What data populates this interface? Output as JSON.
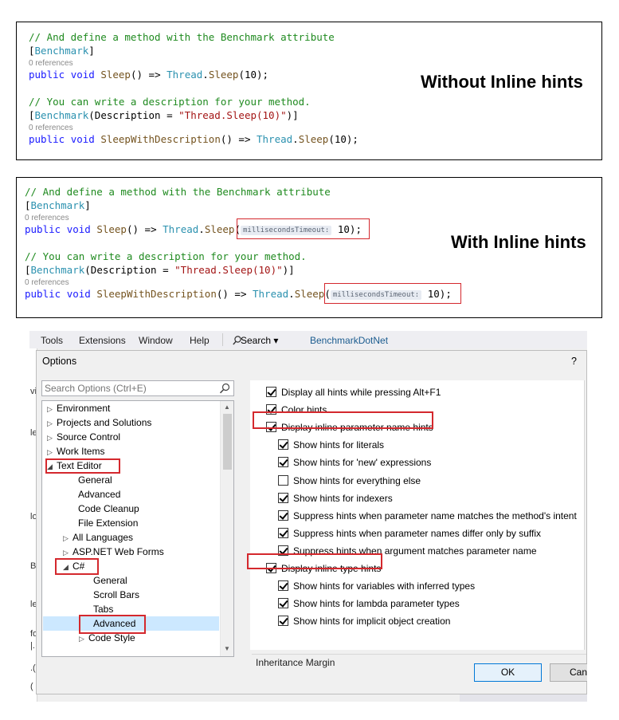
{
  "panel1": {
    "caption": "Without Inline hints",
    "comment1": "// And define a method with the Benchmark attribute",
    "attr_open": "[",
    "attr_name": "Benchmark",
    "attr_close": "]",
    "refs1": "0 references",
    "kw_public": "public",
    "kw_void": "void",
    "method1": "Sleep",
    "method1_tail": "() => ",
    "type_thread": "Thread",
    "call_sleep": "Sleep",
    "args": "(10);",
    "comment2": "// You can write a description for your method.",
    "attr2_open": "[",
    "attr2_name": "Benchmark",
    "attr2_mid": "(Description = ",
    "attr2_str": "\"Thread.Sleep(10)\"",
    "attr2_close": ")]",
    "refs2": "0 references",
    "method2": "SleepWithDescription",
    "method2_tail": "() => "
  },
  "panel2": {
    "caption": "With Inline hints",
    "comment1": "// And define a method with the Benchmark attribute",
    "attr_open": "[",
    "attr_name": "Benchmark",
    "attr_close": "]",
    "refs1": "0 references",
    "kw_public": "public",
    "kw_void": "void",
    "method1": "Sleep",
    "method1_tail": "() => ",
    "type_thread": "Thread",
    "call_sleep": "Sleep",
    "paren": "(",
    "hint": "millisecondsTimeout:",
    "arg_tail": " 10);",
    "comment2": "// You can write a description for your method.",
    "attr2_open": "[",
    "attr2_name": "Benchmark",
    "attr2_mid": "(Description = ",
    "attr2_str": "\"Thread.Sleep(10)\"",
    "attr2_close": ")]",
    "refs2": "0 references",
    "method2": "SleepWithDescription",
    "method2_tail": "() => "
  },
  "vs": {
    "menu": [
      "Tools",
      "Extensions",
      "Window",
      "Help"
    ],
    "search_menu": "Search ▾",
    "solution_name": "BenchmarkDotNet",
    "strip_chars": [
      "vi",
      "le",
      "lo",
      "B",
      "le",
      "fo",
      "|.",
      ".(",
      "("
    ],
    "dialog": {
      "title": "Options",
      "help": "?",
      "search_placeholder": "Search Options (Ctrl+E)",
      "tree": [
        {
          "label": "Environment",
          "arrow": "▷"
        },
        {
          "label": "Projects and Solutions",
          "arrow": "▷"
        },
        {
          "label": "Source Control",
          "arrow": "▷"
        },
        {
          "label": "Work Items",
          "arrow": "▷"
        },
        {
          "label": "Text Editor",
          "arrow": "◢"
        },
        {
          "label": "General",
          "arrow": ""
        },
        {
          "label": "Advanced",
          "arrow": ""
        },
        {
          "label": "Code Cleanup",
          "arrow": ""
        },
        {
          "label": "File Extension",
          "arrow": ""
        },
        {
          "label": "All Languages",
          "arrow": "▷"
        },
        {
          "label": "ASP.NET Web Forms",
          "arrow": "▷"
        },
        {
          "label": "C#",
          "arrow": "◢"
        },
        {
          "label": "General",
          "arrow": ""
        },
        {
          "label": "Scroll Bars",
          "arrow": ""
        },
        {
          "label": "Tabs",
          "arrow": ""
        },
        {
          "label": "Advanced",
          "arrow": ""
        },
        {
          "label": "Code Style",
          "arrow": "▷"
        }
      ],
      "options": [
        {
          "label": "Display all hints while pressing Alt+F1",
          "checked": true
        },
        {
          "label": "Color hints",
          "checked": true
        },
        {
          "label": "Display inline parameter name hints",
          "checked": true
        },
        {
          "label": "Show hints for literals",
          "checked": true
        },
        {
          "label": "Show hints for 'new' expressions",
          "checked": true
        },
        {
          "label": "Show hints for everything else",
          "checked": false
        },
        {
          "label": "Show hints for indexers",
          "checked": true
        },
        {
          "label": "Suppress hints when parameter name matches the method's intent",
          "checked": true
        },
        {
          "label": "Suppress hints when parameter names differ only by suffix",
          "checked": true
        },
        {
          "label": "Suppress hints when argument matches parameter name",
          "checked": true
        },
        {
          "label": "Display inline type hints",
          "checked": true
        },
        {
          "label": "Show hints for variables with inferred types",
          "checked": true
        },
        {
          "label": "Show hints for lambda parameter types",
          "checked": true
        },
        {
          "label": "Show hints for implicit object creation",
          "checked": true
        }
      ],
      "section_header": "Inheritance Margin",
      "ok_label": "OK",
      "cancel_label": "Cancel"
    }
  },
  "colors": {
    "highlight_red": "#d4282d",
    "comment_green": "#1f8a1f",
    "keyword_blue": "#1a1aff",
    "type_teal": "#2b91af",
    "string_red": "#a31515",
    "selection_blue": "#cce8ff"
  }
}
